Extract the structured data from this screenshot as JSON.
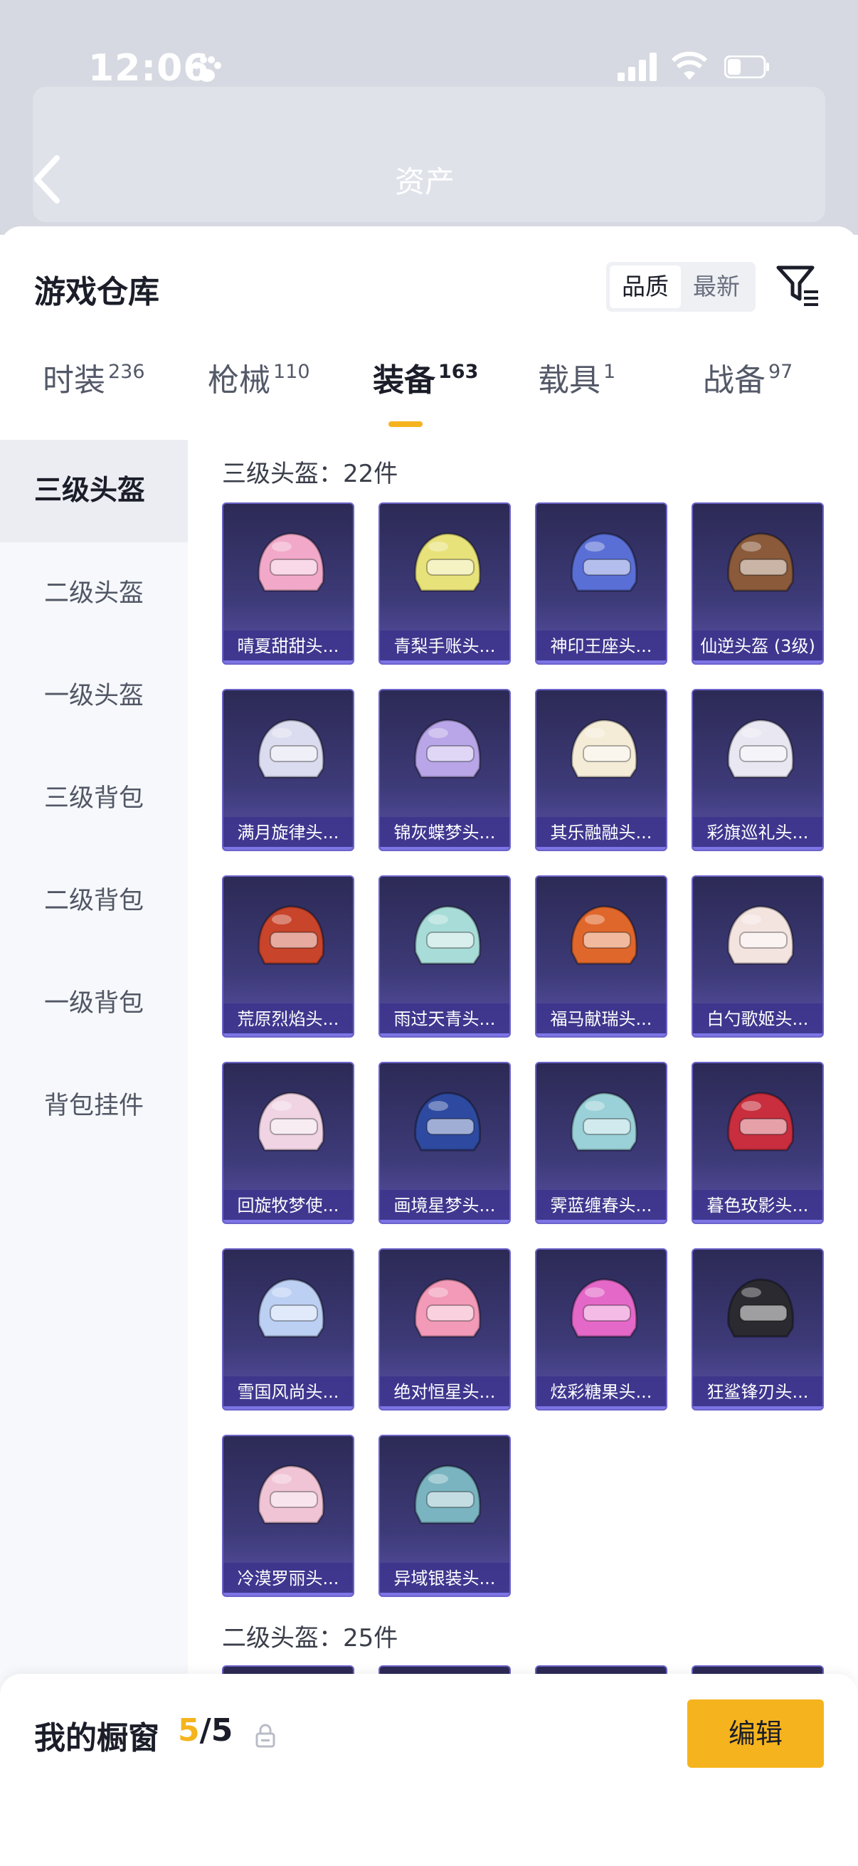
{
  "status_bar": {
    "time": "12:06"
  },
  "background_page": {
    "title": "资产"
  },
  "sheet": {
    "title": "游戏仓库",
    "sort_options": [
      "品质",
      "最新"
    ],
    "selected_sort": "品质"
  },
  "tabs": [
    {
      "label": "时装",
      "count": "236"
    },
    {
      "label": "枪械",
      "count": "110"
    },
    {
      "label": "装备",
      "count": "163"
    },
    {
      "label": "载具",
      "count": "1"
    },
    {
      "label": "战备",
      "count": "97"
    }
  ],
  "active_tab": "装备",
  "categories": [
    "三级头盔",
    "二级头盔",
    "一级头盔",
    "三级背包",
    "二级背包",
    "一级背包",
    "背包挂件"
  ],
  "active_category": "三级头盔",
  "sections": [
    {
      "title": "三级头盔：22件",
      "items": [
        {
          "name": "晴夏甜甜头...",
          "color": "#f2a9c9"
        },
        {
          "name": "青梨手账头...",
          "color": "#e8e27a"
        },
        {
          "name": "神印王座头...",
          "color": "#5a6fd6"
        },
        {
          "name": "仙逆头盔 (3级)",
          "color": "#8a5a3a"
        },
        {
          "name": "满月旋律头...",
          "color": "#dcdcf0"
        },
        {
          "name": "锦灰蝶梦头...",
          "color": "#b8a6e8"
        },
        {
          "name": "其乐融融头...",
          "color": "#f5ecd8"
        },
        {
          "name": "彩旗巡礼头...",
          "color": "#e9e7f2"
        },
        {
          "name": "荒原烈焰头...",
          "color": "#c8442a"
        },
        {
          "name": "雨过天青头...",
          "color": "#a8dcd8"
        },
        {
          "name": "福马献瑞头...",
          "color": "#e0672c"
        },
        {
          "name": "白勺歌姬头...",
          "color": "#f4e4e0"
        },
        {
          "name": "回旋牧梦使...",
          "color": "#f0d4e4"
        },
        {
          "name": "画境星梦头...",
          "color": "#2e4aa0"
        },
        {
          "name": "霁蓝缠春头...",
          "color": "#9ad0d8"
        },
        {
          "name": "暮色玫影头...",
          "color": "#c82e3e"
        },
        {
          "name": "雪国风尚头...",
          "color": "#bcd0f4"
        },
        {
          "name": "绝对恒星头...",
          "color": "#f29ab8"
        },
        {
          "name": "炫彩糖果头...",
          "color": "#e468c8"
        },
        {
          "name": "狂鲨锋刃头...",
          "color": "#2a2a30"
        },
        {
          "name": "冷漠罗丽头...",
          "color": "#f0c4d4"
        },
        {
          "name": "异域银装头...",
          "color": "#7ab4c0"
        }
      ]
    },
    {
      "title": "二级头盔：25件"
    }
  ],
  "showcase": {
    "label": "我的橱窗",
    "current": "5",
    "separator": "/",
    "total": "5",
    "edit_label": "编辑"
  },
  "colors": {
    "accent": "#f5b41e",
    "card_bg": "#3d3a78"
  }
}
